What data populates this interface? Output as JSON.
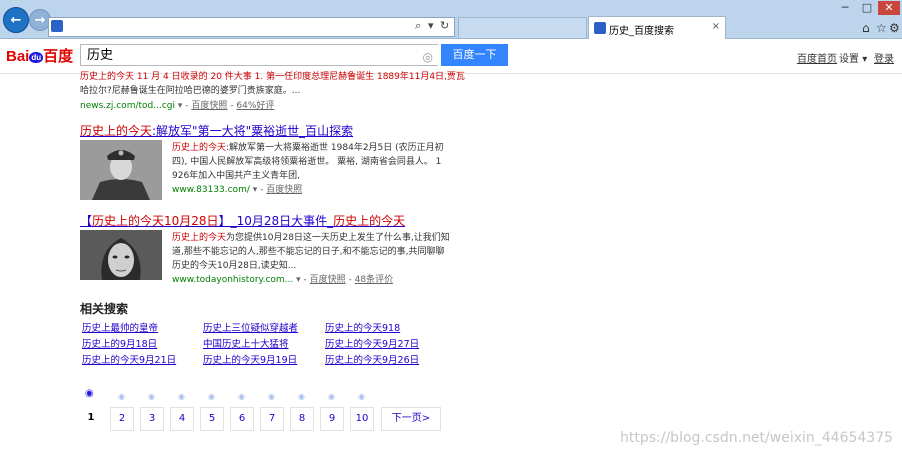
{
  "chrome": {
    "tab_title": "历史_百度搜索",
    "tab_close": "×",
    "win_min": "─",
    "win_max": "□",
    "win_close": "✕",
    "home_icon": "⌂",
    "star_icon": "☆",
    "gear_icon": "⚙",
    "search_glyph": "⌕",
    "refresh_glyph": "↻"
  },
  "search": {
    "logo_bai": "Bai",
    "logo_du": "du",
    "logo_cn": "百度",
    "query": "历史",
    "button": "百度一下",
    "camera": "◎"
  },
  "toplinks": {
    "home": "百度首页",
    "settings": "设置",
    "login": "登录"
  },
  "results": [
    {
      "partial_title": "历史上的今天 11 月 4 日收录的 20 件大事 1. 第一任印度总理尼赫鲁诞生 1889年11月4日,贾瓦",
      "abstract_line": "哈拉尔?尼赫鲁诞生在阿拉哈巴德的婆罗门贵族家庭。...",
      "url": "news.zj.com/tod...cgi",
      "snapshot": "百度快照",
      "rating": "64%好评"
    },
    {
      "title_hl": "历史上的今天",
      "title_rest": ":解放军\"第一大将\"粟裕逝世_百山探索",
      "abs1_hl": "历史上的今天",
      "abs1_rest": ":解放军第一大将粟裕逝世 1984年2月5日 (农历正月初",
      "abs2": "四), 中国人民解放军高级将领粟裕逝世。 粟裕, 湖南省会同县人。 1",
      "abs3": "926年加入中国共产主义青年团,",
      "url": "www.83133.com/",
      "snapshot": "百度快照"
    },
    {
      "title_pre": "【",
      "title_hl": "历史上的今天10月28日",
      "title_mid": "】_10月28日大事件_",
      "title_hl2": "历史上的今天",
      "abs1_hl": "历史上的今天",
      "abs1_rest": "为您提供10月28日这一天历史上发生了什么事,让我们知",
      "abs2": "道,那些不能忘记的人,那些不能忘记的日子,和不能忘记的事,共同聊聊",
      "abs3": "历史的今天10月28日,读史知...",
      "url": "www.todayonhistory.com...",
      "snapshot": "百度快照",
      "rating": "48条评价"
    }
  ],
  "related": {
    "heading": "相关搜索",
    "links": [
      "历史上最帅的皇帝",
      "历史上三位疑似穿越者",
      "历史上的今天918",
      "历史上的9月18日",
      "中国历史上十大猛将",
      "历史上的今天9月27日",
      "历史上的今天9月21日",
      "历史上的今天9月19日",
      "历史上的今天9月26日"
    ]
  },
  "pagination": {
    "current": "1",
    "pages": [
      "2",
      "3",
      "4",
      "5",
      "6",
      "7",
      "8",
      "9",
      "10"
    ],
    "next": "下一页>"
  },
  "watermark": "https://blog.csdn.net/weixin_44654375"
}
